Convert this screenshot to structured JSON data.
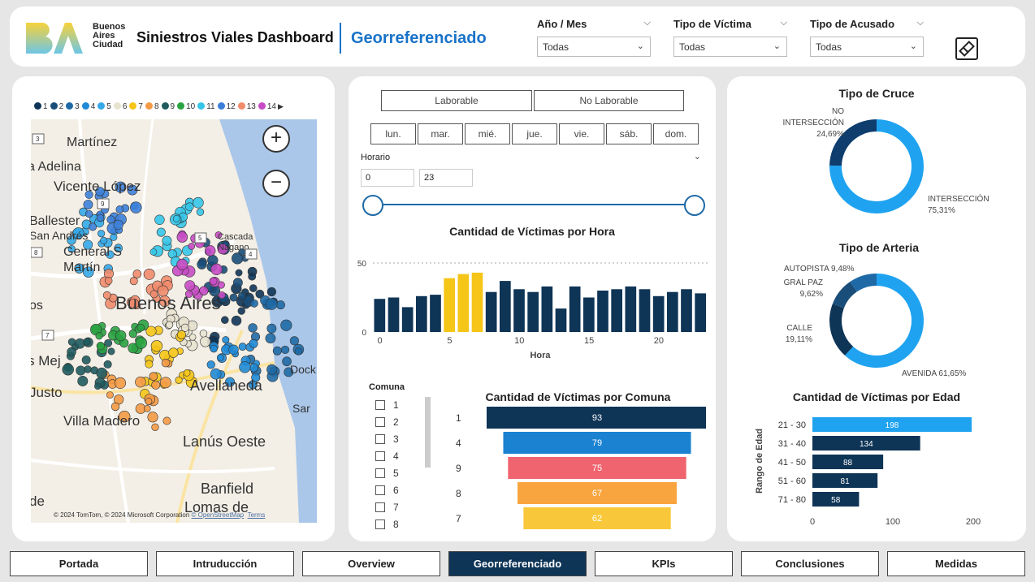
{
  "header": {
    "logo_text": [
      "Buenos",
      "Aires",
      "Ciudad"
    ],
    "title": "Siniestros Viales Dashboard",
    "subtitle": "Georreferenciado",
    "filters": [
      {
        "label": "Año / Mes",
        "value": "Todas"
      },
      {
        "label": "Tipo de Víctima",
        "value": "Todas"
      },
      {
        "label": "Tipo de Acusado",
        "value": "Todas"
      }
    ],
    "clear_filters_icon": "eraser-icon"
  },
  "map": {
    "legend": [
      {
        "label": "1",
        "color": "#0e3456"
      },
      {
        "label": "2",
        "color": "#1a4e7a"
      },
      {
        "label": "3",
        "color": "#1f6aa6"
      },
      {
        "label": "4",
        "color": "#1f8ad6"
      },
      {
        "label": "5",
        "color": "#35a9e8"
      },
      {
        "label": "6",
        "color": "#e8e3d0"
      },
      {
        "label": "7",
        "color": "#f5c518"
      },
      {
        "label": "8",
        "color": "#f49a45"
      },
      {
        "label": "9",
        "color": "#1f5b5f"
      },
      {
        "label": "10",
        "color": "#2aa343"
      },
      {
        "label": "11",
        "color": "#35c5e8"
      },
      {
        "label": "12",
        "color": "#3c7fd9"
      },
      {
        "label": "13",
        "color": "#f08b6b"
      },
      {
        "label": "14",
        "color": "#c64bc4"
      }
    ],
    "place_labels": [
      "Martínez",
      "a Adelina",
      "Vicente López",
      "Ballester",
      "San Andrés",
      "General S",
      "Martín",
      "Cascada",
      "Nagano",
      "Buenos Aires",
      "os",
      "s Mej",
      "Justo",
      "Villa Madero",
      "Avellaneda",
      "Lanús Oeste",
      "Banfield",
      "Lomas de",
      "Dock",
      "Sar",
      "de"
    ],
    "road_markers": [
      "3",
      "9",
      "8",
      "5",
      "7",
      "4"
    ],
    "zoom_in": "+",
    "zoom_out": "−",
    "attribution": "© 2024 TomTom, © 2024 Microsoft Corporation",
    "attribution_links": [
      "© OpenStreetMap",
      "Terms"
    ]
  },
  "middle": {
    "day_type": [
      "Laborable",
      "No Laborable"
    ],
    "weekdays": [
      "lun.",
      "mar.",
      "mié.",
      "jue.",
      "vie.",
      "sáb.",
      "dom."
    ],
    "horario_label": "Horario",
    "horario_min": "0",
    "horario_max": "23",
    "hour_chart_title": "Cantidad de Víctimas por Hora",
    "hour_xlabel": "Hora",
    "comuna_label": "Comuna",
    "comuna_items": [
      "1",
      "2",
      "3",
      "4",
      "5",
      "6",
      "7",
      "8"
    ],
    "comuna_chart_title": "Cantidad de Víctimas por Comuna"
  },
  "right": {
    "cruce_title": "Tipo de Cruce",
    "cruce_labels": [
      {
        "name": "NO INTERSECCIÓN",
        "pct": "24,69%"
      },
      {
        "name": "INTERSECCIÓN",
        "pct": "75,31%"
      }
    ],
    "arteria_title": "Tipo de Arteria",
    "arteria_labels": [
      {
        "name": "AUTOPISTA",
        "pct": "9,48%"
      },
      {
        "name": "GRAL PAZ",
        "pct": "9,62%"
      },
      {
        "name": "CALLE",
        "pct": "19,11%"
      },
      {
        "name": "AVENIDA",
        "pct": "61,65%"
      }
    ],
    "edad_title": "Cantidad de Víctimas por Edad",
    "edad_ylabel": "Rango de Edad"
  },
  "nav": {
    "tabs": [
      "Portada",
      "Intruducción",
      "Overview",
      "Georreferenciado",
      "KPIs",
      "Conclusiones",
      "Medidas"
    ],
    "active": "Georreferenciado"
  },
  "chart_data": [
    {
      "type": "bar",
      "title": "Cantidad de Víctimas por Hora",
      "xlabel": "Hora",
      "ylabel": "",
      "x": [
        0,
        1,
        2,
        3,
        4,
        5,
        6,
        7,
        8,
        9,
        10,
        11,
        12,
        13,
        14,
        15,
        16,
        17,
        18,
        19,
        20,
        21,
        22,
        23
      ],
      "values": [
        24,
        25,
        18,
        26,
        27,
        39,
        42,
        43,
        29,
        37,
        31,
        29,
        33,
        17,
        33,
        25,
        30,
        31,
        33,
        31,
        26,
        29,
        31,
        28
      ],
      "highlighted": [
        5,
        6,
        7
      ],
      "highlight_color": "#f5c518",
      "color": "#0e3456",
      "xticks": [
        0,
        5,
        10,
        15,
        20
      ],
      "yticks": [
        0,
        50
      ],
      "ylim": [
        0,
        50
      ]
    },
    {
      "type": "bar",
      "title": "Cantidad de Víctimas por Comuna",
      "orientation": "horizontal-funnel",
      "categories": [
        "1",
        "4",
        "9",
        "8",
        "7"
      ],
      "values": [
        93,
        79,
        75,
        67,
        62
      ],
      "colors": [
        "#0e3456",
        "#1a82d0",
        "#f0646f",
        "#f9a53f",
        "#f9c83a"
      ]
    },
    {
      "type": "pie",
      "title": "Tipo de Cruce",
      "donut": true,
      "categories": [
        "INTERSECCIÓN",
        "NO INTERSECCIÓN"
      ],
      "values": [
        75.31,
        24.69
      ],
      "colors": [
        "#1fa3f0",
        "#0e3d6e"
      ]
    },
    {
      "type": "pie",
      "title": "Tipo de Arteria",
      "donut": true,
      "categories": [
        "AVENIDA",
        "CALLE",
        "GRAL PAZ",
        "AUTOPISTA"
      ],
      "values": [
        61.65,
        19.11,
        9.62,
        9.48
      ],
      "colors": [
        "#1fa3f0",
        "#0e3456",
        "#1a4e7a",
        "#1f6aa6"
      ]
    },
    {
      "type": "bar",
      "title": "Cantidad de Víctimas por Edad",
      "orientation": "horizontal",
      "ylabel": "Rango de Edad",
      "categories": [
        "21 - 30",
        "31 - 40",
        "41 - 50",
        "51 - 60",
        "71 - 80"
      ],
      "values": [
        198,
        134,
        88,
        81,
        58
      ],
      "colors": [
        "#1fa3f0",
        "#0e3456",
        "#0e3456",
        "#0e3456",
        "#0e3456"
      ],
      "xticks": [
        0,
        100,
        200
      ],
      "xlim": [
        0,
        200
      ]
    }
  ]
}
